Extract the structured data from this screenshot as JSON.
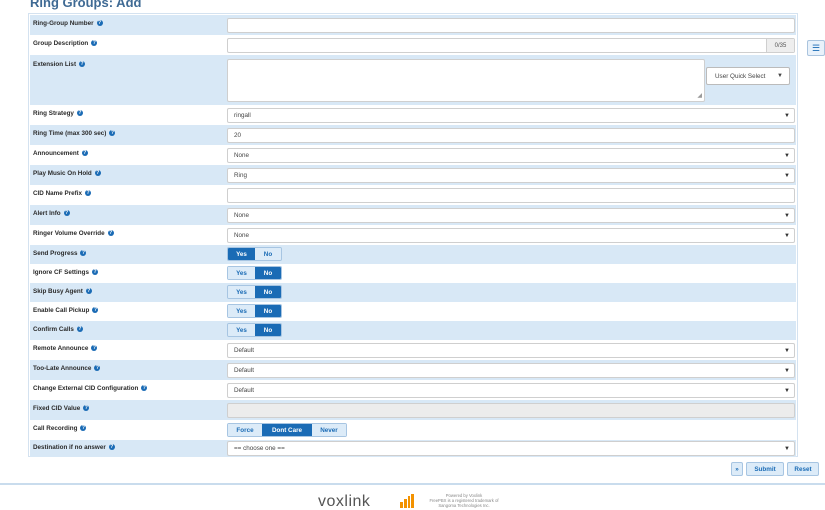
{
  "page": {
    "title": "Ring Groups: Add"
  },
  "rows": {
    "ring_group_number": {
      "label": "Ring-Group Number",
      "value": ""
    },
    "group_description": {
      "label": "Group Description",
      "value": "",
      "counter": "0/35"
    },
    "extension_list": {
      "label": "Extension List",
      "quick_select": "User Quick Select"
    },
    "ring_strategy": {
      "label": "Ring Strategy",
      "value": "ringall"
    },
    "ring_time": {
      "label": "Ring Time (max 300 sec)",
      "value": "20"
    },
    "announcement": {
      "label": "Announcement",
      "value": "None"
    },
    "play_moh": {
      "label": "Play Music On Hold",
      "value": "Ring"
    },
    "cid_prefix": {
      "label": "CID Name Prefix",
      "value": ""
    },
    "alert_info": {
      "label": "Alert Info",
      "value": "None"
    },
    "ringer_volume": {
      "label": "Ringer Volume Override",
      "value": "None"
    },
    "send_progress": {
      "label": "Send Progress",
      "yes": "Yes",
      "no": "No",
      "selected": "Yes"
    },
    "ignore_cf": {
      "label": "Ignore CF Settings",
      "yes": "Yes",
      "no": "No",
      "selected": "No"
    },
    "skip_busy": {
      "label": "Skip Busy Agent",
      "yes": "Yes",
      "no": "No",
      "selected": "No"
    },
    "call_pickup": {
      "label": "Enable Call Pickup",
      "yes": "Yes",
      "no": "No",
      "selected": "No"
    },
    "confirm_calls": {
      "label": "Confirm Calls",
      "yes": "Yes",
      "no": "No",
      "selected": "No"
    },
    "remote_announce": {
      "label": "Remote Announce",
      "value": "Default"
    },
    "too_late_announce": {
      "label": "Too-Late Announce",
      "value": "Default"
    },
    "change_ext_cid": {
      "label": "Change External CID Configuration",
      "value": "Default"
    },
    "fixed_cid": {
      "label": "Fixed CID Value",
      "value": ""
    },
    "call_recording": {
      "label": "Call Recording",
      "force": "Force",
      "dont_care": "Dont Care",
      "never": "Never",
      "selected": "Dont Care"
    },
    "destination": {
      "label": "Destination if no answer",
      "value": "== choose one =="
    }
  },
  "help_glyph": "?",
  "arrow_glyph": "▼",
  "actions": {
    "more": "»",
    "submit": "Submit",
    "reset": "Reset"
  },
  "side_button_icon": "list-icon",
  "footer": {
    "logo_text": "voxlink",
    "powered_lines": [
      "Powered by Voxlink",
      "FreePBX is a registered trademark of",
      "Sangoma Technologies Inc."
    ]
  },
  "colors": {
    "accent": "#1a6bb5",
    "row_alt": "#d8e8f6",
    "title": "#3f6a94",
    "logo_mark": "#f39200"
  }
}
